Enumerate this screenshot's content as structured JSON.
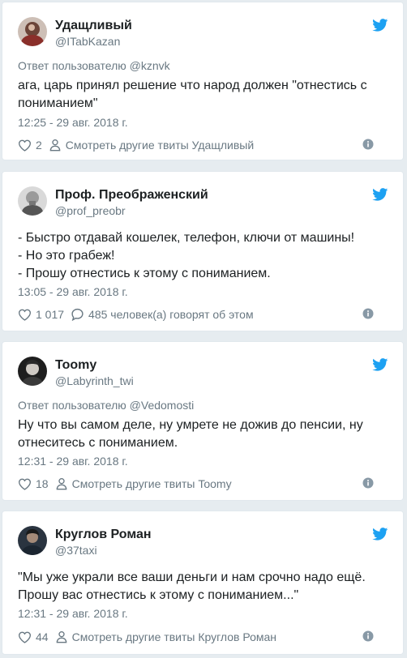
{
  "tweets": [
    {
      "name": "Удащливый",
      "handle": "@ITabKazan",
      "reply_to": "Ответ пользователю @kznvk",
      "text": "ага, царь принял решение что  народ должен \"отнестись с пониманием\"",
      "time": "12:25 - 29 авг. 2018 г.",
      "likes": "2",
      "secondary_action": "Смотреть другие твиты Удащливый"
    },
    {
      "name": "Проф. Преображенский",
      "handle": "@prof_preobr",
      "reply_to": "",
      "text": "- Быстро отдавай кошелек, телефон, ключи от машины!\n- Но это грабеж!\n- Прошу отнестись к этому с пониманием.",
      "time": "13:05 - 29 авг. 2018 г.",
      "likes": "1 017",
      "secondary_action": "485 человек(а) говорят об этом"
    },
    {
      "name": "Toomy",
      "handle": "@Labyrinth_twi",
      "reply_to": "Ответ пользователю @Vedomosti",
      "text": "Ну что вы самом деле, ну умрете не дожив до пенсии, ну отнеситесь с пониманием.",
      "time": "12:31 - 29 авг. 2018 г.",
      "likes": "18",
      "secondary_action": "Смотреть другие твиты Toomy"
    },
    {
      "name": "Круглов Роман",
      "handle": "@37taxi",
      "reply_to": "",
      "text": "\"Мы уже украли все ваши деньги и нам срочно надо ещё. Прошу вас отнестись к этому с пониманием...\"",
      "time": "12:31 - 29 авг. 2018 г.",
      "likes": "44",
      "secondary_action": "Смотреть другие твиты Круглов Роман"
    }
  ],
  "icons": {
    "brand": "twitter-bird-icon",
    "like": "heart-icon",
    "profile": "person-icon",
    "comments": "speech-bubble-icon",
    "info": "info-icon"
  },
  "colors": {
    "twitter_blue": "#1da1f2",
    "text": "#1c2022",
    "muted": "#697882",
    "background": "#e6ecf0"
  }
}
